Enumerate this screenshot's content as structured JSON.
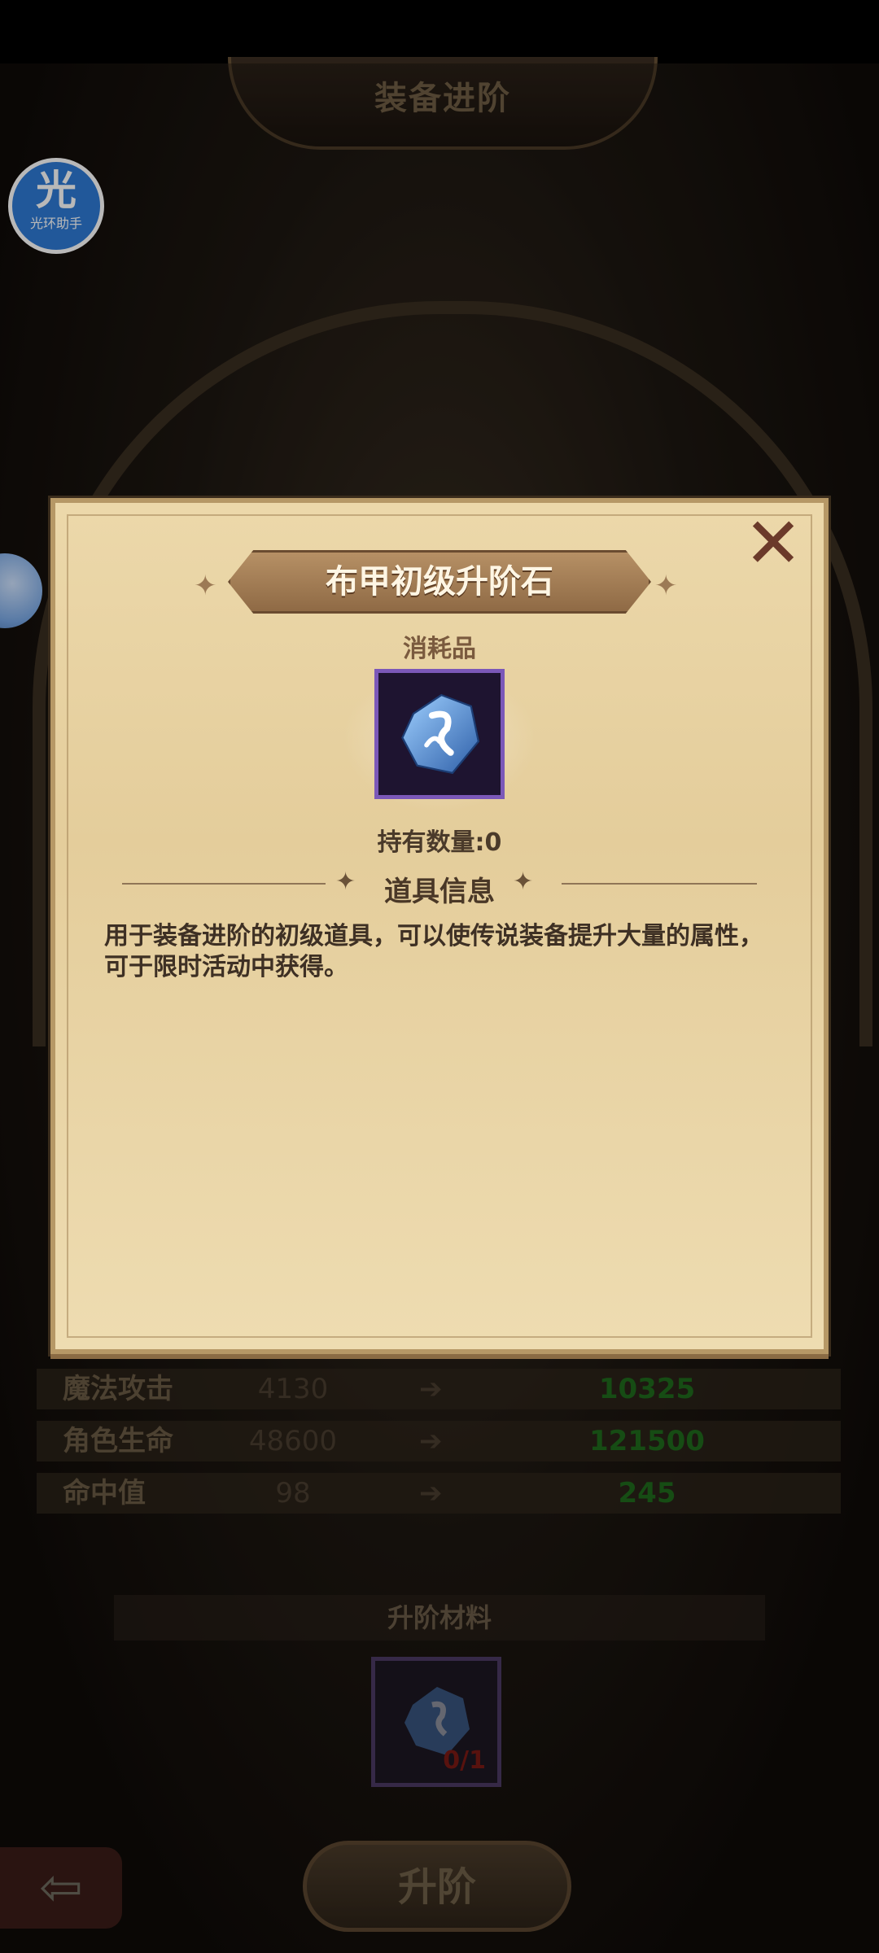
{
  "background": {
    "screen_title": "装备进阶",
    "assistant": {
      "char": "光",
      "label": "光环助手"
    },
    "stats": [
      {
        "name": "魔法攻击",
        "old": "4130",
        "new": "10325"
      },
      {
        "name": "角色生命",
        "old": "48600",
        "new": "121500"
      },
      {
        "name": "命中值",
        "old": "98",
        "new": "245"
      }
    ],
    "material_label": "升阶材料",
    "material_count": "0/1",
    "upgrade_label": "升阶",
    "back_glyph": "⇦"
  },
  "modal": {
    "close_glyph": "✕",
    "title": "布甲初级升阶石",
    "item_type": "消耗品",
    "owned_text": "持有数量:0",
    "section_title": "道具信息",
    "description": "用于装备进阶的初级道具，可以使传说装备提升大量的属性，可于限时活动中获得。",
    "icon": "blue-upgrade-stone-icon"
  },
  "colors": {
    "parchment": "#ecd8aa",
    "item_border": "#7b58b8",
    "stat_new": "#1f6a1c"
  }
}
